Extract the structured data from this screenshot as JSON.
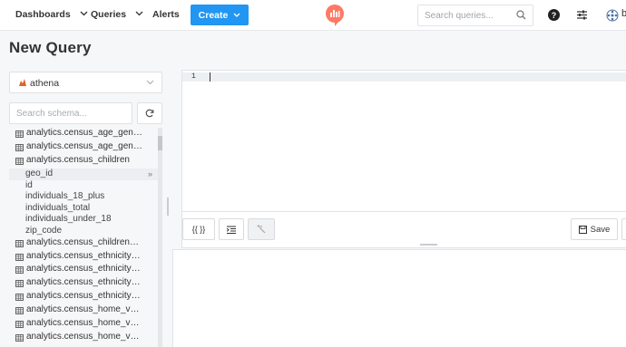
{
  "nav": {
    "dashboards": "Dashboards",
    "queries": "Queries",
    "alerts": "Alerts",
    "create": "Create",
    "search_placeholder": "Search queries...",
    "user": "b"
  },
  "page_title": "New Query",
  "data_source": {
    "selected": "athena"
  },
  "schema": {
    "search_placeholder": "Search schema...",
    "items": [
      {
        "kind": "table",
        "label": "analytics.census_age_gende..."
      },
      {
        "kind": "table",
        "label": "analytics.census_age_gende..."
      },
      {
        "kind": "table",
        "label": "analytics.census_children"
      },
      {
        "kind": "column",
        "label": "geo_id",
        "active": true
      },
      {
        "kind": "column",
        "label": "id"
      },
      {
        "kind": "column",
        "label": "individuals_18_plus"
      },
      {
        "kind": "column",
        "label": "individuals_total"
      },
      {
        "kind": "column",
        "label": "individuals_under_18"
      },
      {
        "kind": "column",
        "label": "zip_code"
      },
      {
        "kind": "table",
        "label": "analytics.census_children_d..."
      },
      {
        "kind": "table",
        "label": "analytics.census_ethnicity_h..."
      },
      {
        "kind": "table",
        "label": "analytics.census_ethnicity_h..."
      },
      {
        "kind": "table",
        "label": "analytics.census_ethnicity_p..."
      },
      {
        "kind": "table",
        "label": "analytics.census_ethnicity_p..."
      },
      {
        "kind": "table",
        "label": "analytics.census_home_valu..."
      },
      {
        "kind": "table",
        "label": "analytics.census_home_valu..."
      },
      {
        "kind": "table",
        "label": "analytics.census_home_valu..."
      }
    ],
    "insert_arrow": "»"
  },
  "editor": {
    "line_number": "1",
    "content": ""
  },
  "toolbar": {
    "params_label": "{{ }}",
    "save_label": "Save"
  },
  "colors": {
    "accent": "#2196f3",
    "logo": "#ff7964"
  }
}
